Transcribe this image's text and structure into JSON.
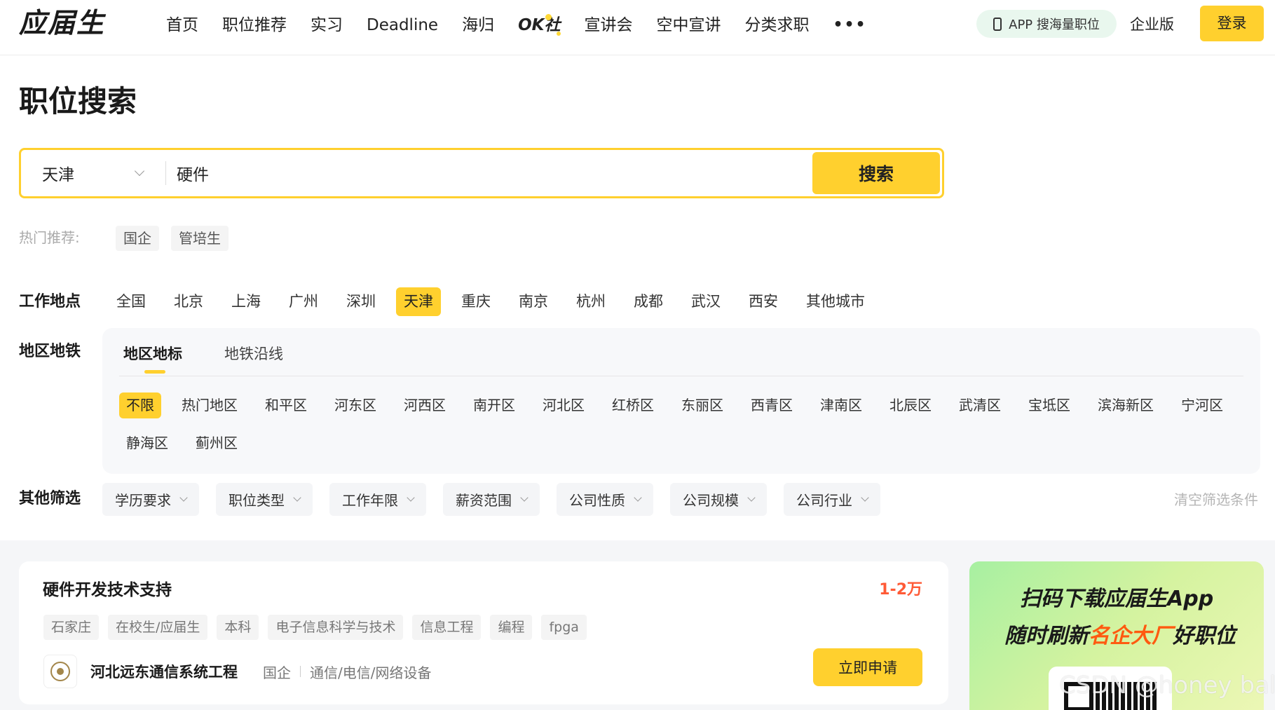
{
  "header": {
    "logo": "应届生",
    "nav": [
      "首页",
      "职位推荐",
      "实习",
      "Deadline",
      "海归",
      "OK社",
      "宣讲会",
      "空中宣讲",
      "分类求职"
    ],
    "more_icon": "more-dots-icon",
    "app_pill": "APP 搜海量职位",
    "business": "企业版",
    "login": "登录"
  },
  "page_title": "职位搜索",
  "search": {
    "city": "天津",
    "query": "硬件",
    "button": "搜索"
  },
  "hot": {
    "label": "热门推荐:",
    "tags": [
      "国企",
      "管培生"
    ]
  },
  "location": {
    "label": "工作地点",
    "cities": [
      "全国",
      "北京",
      "上海",
      "广州",
      "深圳",
      "天津",
      "重庆",
      "南京",
      "杭州",
      "成都",
      "武汉",
      "西安",
      "其他城市"
    ],
    "selected": "天津"
  },
  "district": {
    "label": "地区地铁",
    "tabs": [
      "地区地标",
      "地铁沿线"
    ],
    "active_tab": "地区地标",
    "items": [
      "不限",
      "热门地区",
      "和平区",
      "河东区",
      "河西区",
      "南开区",
      "河北区",
      "红桥区",
      "东丽区",
      "西青区",
      "津南区",
      "北辰区",
      "武清区",
      "宝坻区",
      "滨海新区",
      "宁河区",
      "静海区",
      "蓟州区"
    ],
    "selected": "不限"
  },
  "other_filters": {
    "label": "其他筛选",
    "filters": [
      "学历要求",
      "职位类型",
      "工作年限",
      "薪资范围",
      "公司性质",
      "公司规模",
      "公司行业"
    ],
    "clear": "清空筛选条件"
  },
  "jobs": [
    {
      "title": "硬件开发技术支持",
      "salary": "1-2万",
      "tags": [
        "石家庄",
        "在校生/应届生",
        "本科",
        "电子信息科学与技术",
        "信息工程",
        "编程",
        "fpga"
      ],
      "company": "河北远东通信系统工程",
      "company_type": "国企",
      "industry": "通信/电信/网络设备",
      "apply": "立即申请"
    }
  ],
  "promo": {
    "line1_a": "扫码下载",
    "line1_b": "应届生",
    "line1_c": "App",
    "line2_a": "随时刷新",
    "line2_b": "名企大厂",
    "line2_c": "好职位",
    "watermark": "CSDN @honey ball"
  },
  "colors": {
    "accent": "#ffd02e",
    "salary": "#ff5a36",
    "promo_highlight": "#ff5a10"
  }
}
